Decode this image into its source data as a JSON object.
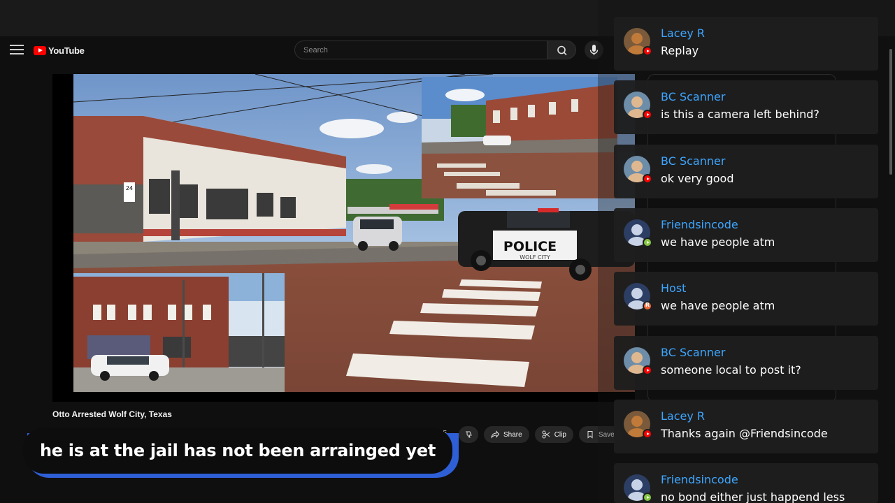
{
  "header": {
    "logo_text": "YouTube",
    "search_placeholder": "Search"
  },
  "video": {
    "title": "Otto Arrested Wolf City, Texas",
    "police_text": "POLICE",
    "police_subtext": "WOLF CITY",
    "sign_number": "24",
    "like_count": "15"
  },
  "actions": {
    "share": "Share",
    "clip": "Clip",
    "save": "Save"
  },
  "caption": {
    "text": "he is at the jail has not been arrainged yet"
  },
  "chat": {
    "messages": [
      {
        "name": "Lacey R",
        "text": "Replay",
        "platform": "youtube"
      },
      {
        "name": "BC Scanner",
        "text": "is this a camera left behind?",
        "platform": "youtube"
      },
      {
        "name": "BC Scanner",
        "text": "ok very good",
        "platform": "youtube"
      },
      {
        "name": "Friendsincode",
        "text": "we have people atm",
        "platform": "rumble"
      },
      {
        "name": "Host",
        "text": "we have people atm",
        "platform": "host"
      },
      {
        "name": "BC Scanner",
        "text": "someone local to post it?",
        "platform": "youtube"
      },
      {
        "name": "Lacey R",
        "text": "Thanks again @Friendsincode",
        "platform": "youtube"
      },
      {
        "name": "Friendsincode",
        "text": "no bond either just happend less",
        "platform": "rumble"
      }
    ]
  },
  "colors": {
    "name_blue": "#3ea6ff",
    "youtube_red": "#ff0000",
    "rumble_green": "#85c742",
    "host_orange": "#f06b3c",
    "caption_accent": "#2f5fd6"
  }
}
